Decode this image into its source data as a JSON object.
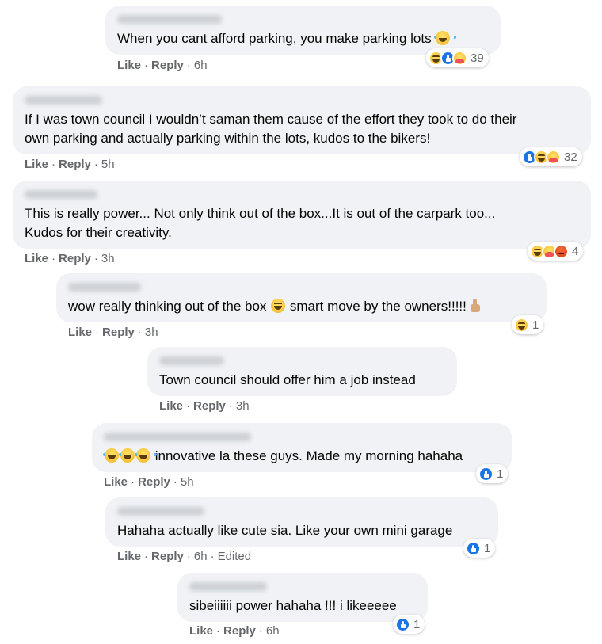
{
  "labels": {
    "like": "Like",
    "reply": "Reply",
    "dot": "·"
  },
  "comments": [
    {
      "text": "When you cant afford parking, you make parking lots",
      "time": "6h",
      "reactions": [
        "haha",
        "like",
        "care"
      ],
      "reaction_count": "39"
    },
    {
      "text_lines": [
        "If I was town council I wouldn’t saman them cause of the effort they took to do their",
        "own parking and actually parking within the lots, kudos to the bikers!"
      ],
      "time": "5h",
      "reactions": [
        "like",
        "haha",
        "care"
      ],
      "reaction_count": "32"
    },
    {
      "text_lines": [
        "This is really power... Not only think out of the box...It is out of the carpark too...",
        "Kudos for their creativity."
      ],
      "time": "3h",
      "reactions": [
        "haha",
        "care",
        "angry"
      ],
      "reaction_count": "4"
    },
    {
      "text_before": "wow really thinking out of the box",
      "text_mid": "smart move by the owners!!!!!",
      "time": "3h",
      "reactions": [
        "haha"
      ],
      "reaction_count": "1"
    },
    {
      "text": "Town council should offer him a job instead",
      "time": "3h"
    },
    {
      "text": "innovative la these guys. Made my morning hahaha",
      "time": "5h",
      "reactions": [
        "like"
      ],
      "reaction_count": "1"
    },
    {
      "text": "Hahaha actually like cute sia. Like your own mini garage",
      "time": "6h",
      "edited": "Edited",
      "reactions": [
        "like"
      ],
      "reaction_count": "1"
    },
    {
      "text": "sibeiiiiii power hahaha !!! i likeeeee",
      "time": "6h",
      "reactions": [
        "like"
      ],
      "reaction_count": "1"
    }
  ],
  "colors": {
    "bubble": "#f0f2f5",
    "meta": "#65676b",
    "like_blue": "#1b74e4",
    "text": "#050505"
  }
}
